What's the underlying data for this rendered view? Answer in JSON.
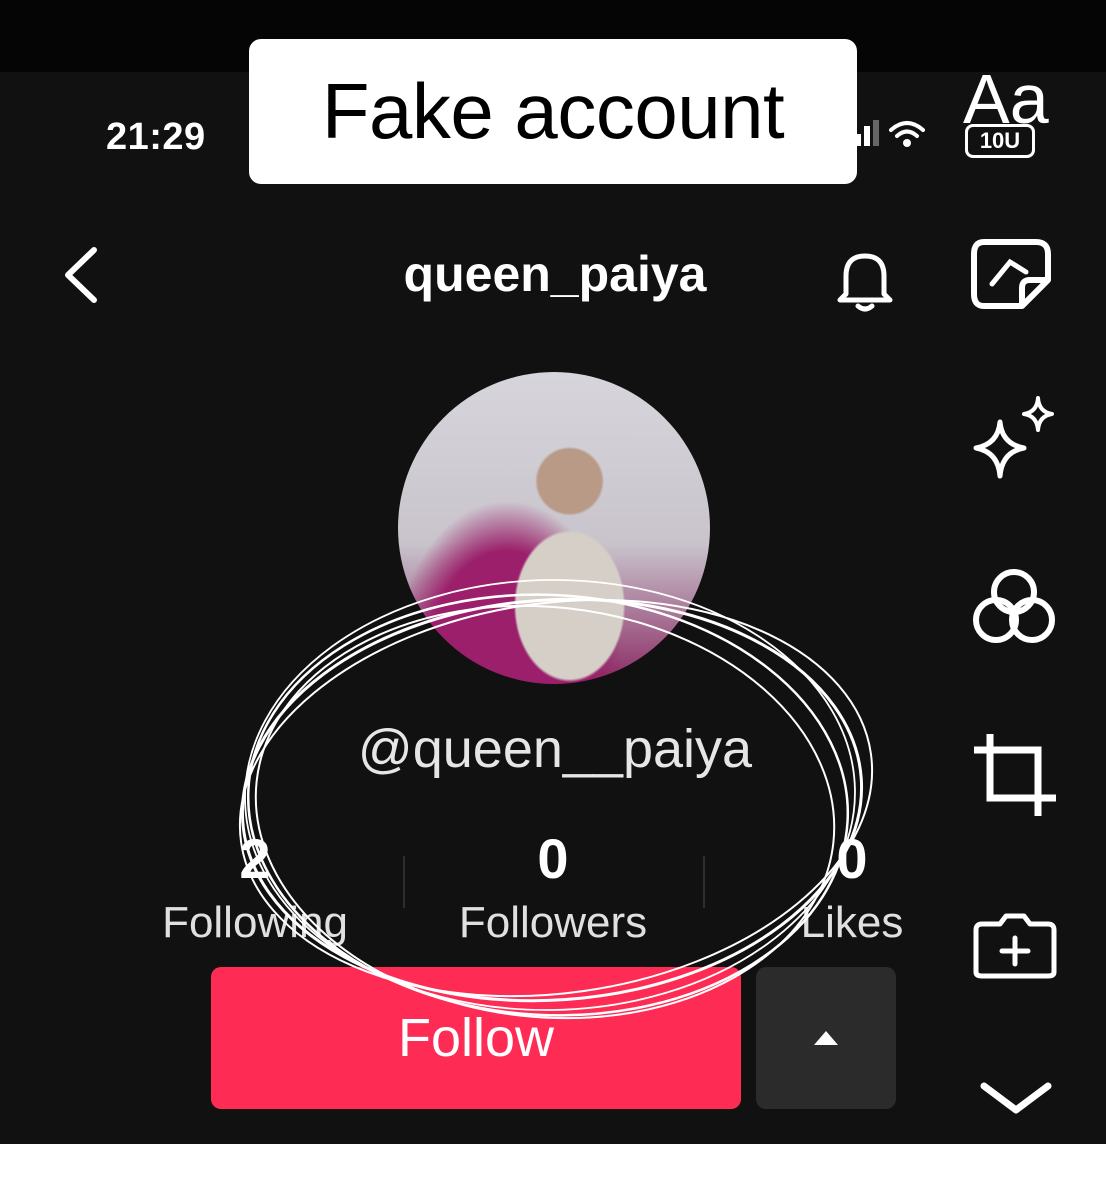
{
  "status_bar": {
    "time": "21:29"
  },
  "caption": {
    "text": "Fake account"
  },
  "header": {
    "title": "queen_paiya"
  },
  "profile": {
    "handle": "@queen__paiya",
    "stats": [
      {
        "value": "2",
        "label": "Following"
      },
      {
        "value": "0",
        "label": "Followers"
      },
      {
        "value": "0",
        "label": "Likes"
      }
    ]
  },
  "actions": {
    "follow_label": "Follow"
  },
  "editor_tools": {
    "text_tool_label": "Aa",
    "text_tool_badge": "10U",
    "items": [
      "text-icon",
      "sticker-icon",
      "sparkle-icon",
      "filter-icon",
      "crop-icon",
      "add-camera-icon",
      "chevron-down-icon"
    ]
  },
  "colors": {
    "accent": "#fe2c55",
    "background": "#111111",
    "caption_bg": "#ffffff"
  }
}
